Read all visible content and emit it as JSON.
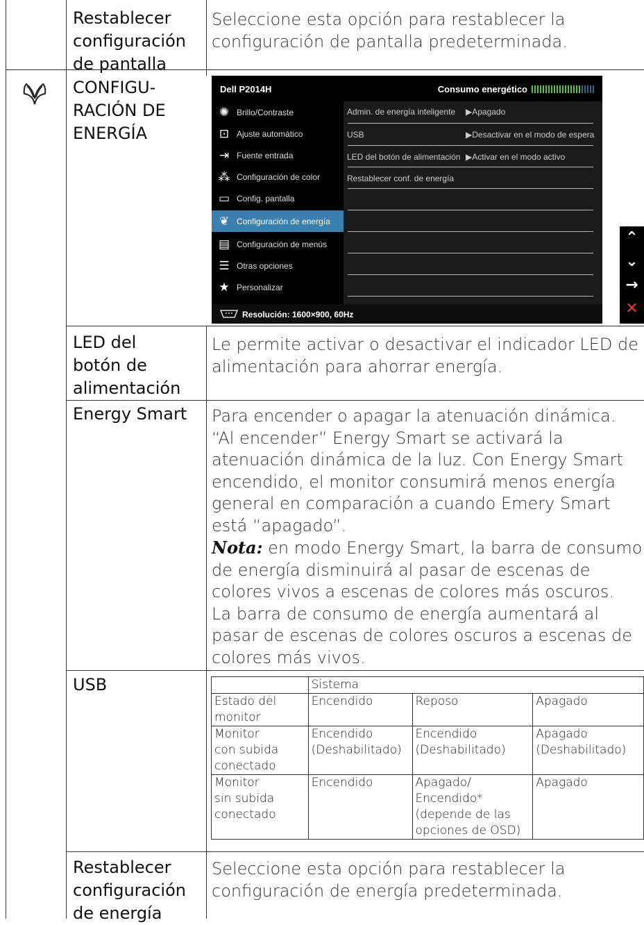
{
  "rows": {
    "reset_display": {
      "term": [
        "Restablecer",
        "configuración",
        "de pantalla"
      ],
      "desc": [
        "Seleccione esta opción para restablecer la",
        "configuración de pantalla predeterminada."
      ]
    },
    "energy_settings": {
      "term": [
        "CONFIGU-",
        "RACIÓN DE",
        "ENERGÍA"
      ],
      "icon": "energy-butterfly-icon"
    },
    "power_led": {
      "term": [
        "LED del",
        "botón de",
        "alimentación"
      ],
      "desc": [
        "Le permite activar o desactivar el indicador LED de",
        "alimentación para ahorrar energía."
      ]
    },
    "energy_smart": {
      "term": [
        "Energy Smart"
      ],
      "desc": [
        "Para encender o apagar la atenuación dinámica.",
        "“Al encender” Energy Smart se activará la",
        "atenuación dinámica de la luz. Con Energy Smart",
        "encendido, el monitor consumirá menos energía",
        "general en comparación a cuando Emery Smart",
        "está “apagado”."
      ],
      "nota_label": "Nota:",
      "nota_first": " en modo Energy Smart, la barra de consumo",
      "nota_rest": [
        "de energía disminuirá al pasar de escenas de",
        "colores vivos a escenas de colores más oscuros.",
        "La barra de consumo de energía aumentará al",
        "pasar de escenas de colores oscuros a escenas de",
        "colores más vivos."
      ]
    },
    "usb": {
      "term": [
        "USB"
      ],
      "table": {
        "header": [
          "",
          "Sistema",
          "",
          ""
        ],
        "rows": [
          [
            [
              "Estado del",
              "monitor"
            ],
            [
              "Encendido"
            ],
            [
              "Reposo"
            ],
            [
              "Apagado"
            ]
          ],
          [
            [
              "Monitor",
              "con subida",
              "conectado"
            ],
            [
              "Encendido",
              "(Deshabilitado)"
            ],
            [
              "Encendido",
              "(Deshabilitado)"
            ],
            [
              "Apagado",
              "(Deshabilitado)"
            ]
          ],
          [
            [
              "Monitor",
              "sin subida",
              "conectado"
            ],
            [
              "Encendido"
            ],
            [
              "Apagado/",
              "Encendido*",
              "(depende de las",
              "opciones de OSD)"
            ],
            [
              "Apagado"
            ]
          ]
        ]
      }
    },
    "reset_energy": {
      "term": [
        "Restablecer",
        "configuración",
        "de energía"
      ],
      "desc": [
        "Seleccione esta opción para restablecer la",
        "configuración de energía predeterminada."
      ]
    }
  },
  "osd": {
    "model": "Dell P2014H",
    "power_label": "Consumo energético",
    "power_level": 0.8,
    "menu": [
      {
        "icon": "brightness-icon",
        "glyph": "✺",
        "label": "Brillo/Contraste",
        "selected": false
      },
      {
        "icon": "auto-adjust-icon",
        "glyph": "⊡",
        "label": "Ajuste  automático",
        "selected": false
      },
      {
        "icon": "input-source-icon",
        "glyph": "⇥",
        "label": "Fuente entrada",
        "selected": false
      },
      {
        "icon": "color-settings-icon",
        "glyph": "⁂",
        "label": "Configuración de color",
        "selected": false
      },
      {
        "icon": "display-settings-icon",
        "glyph": "▭",
        "label": "Config. pantalla",
        "selected": false
      },
      {
        "icon": "energy-settings-icon",
        "glyph": "❦",
        "label": "Configuración de energía",
        "selected": true
      },
      {
        "icon": "menu-settings-icon",
        "glyph": "▤",
        "label": "Configuración de menús",
        "selected": false
      },
      {
        "icon": "other-settings-icon",
        "glyph": "☰",
        "label": "Otras opciones",
        "selected": false
      },
      {
        "icon": "personalize-star-icon",
        "glyph": "★",
        "label": "Personalizar",
        "selected": false
      }
    ],
    "settings": [
      {
        "key": "Admin. de energía inteligente",
        "value": "▶Apagado"
      },
      {
        "key": "USB",
        "value": "▶Desactivar en el modo de espera"
      },
      {
        "key": "LED del botón de alimentación",
        "value": "▶Activar en el modo activo"
      },
      {
        "key": "Restablecer conf. de energía",
        "value": ""
      }
    ],
    "footer": "Resolución: 1600×900,  60Hz",
    "side_buttons": [
      {
        "icon": "up-chevron-icon",
        "glyph": "⌃"
      },
      {
        "icon": "down-chevron-icon",
        "glyph": "⌄"
      },
      {
        "icon": "right-arrow-icon",
        "glyph": "→"
      },
      {
        "icon": "close-x-icon",
        "glyph": "✕",
        "color": "#e53935"
      }
    ]
  }
}
